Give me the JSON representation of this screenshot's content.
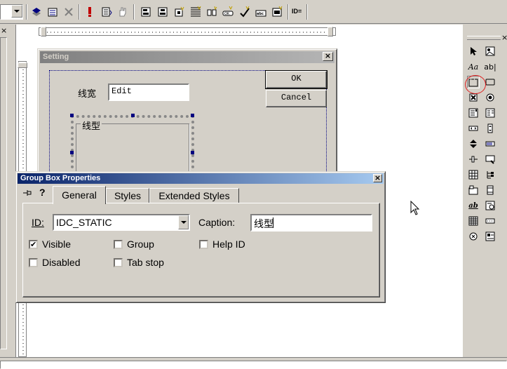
{
  "toolbar": {
    "icons": [
      "dropdown-arrow-icon",
      "class-wizard-icon",
      "resource-icon",
      "cut-disabled-icon",
      "exclamation-icon",
      "list-icon",
      "hand-icon",
      "align-left-icon",
      "align-center-icon",
      "align-right-icon",
      "space-across-icon",
      "make-same-size-icon",
      "size-to-content-icon",
      "check-mnemonics-icon",
      "grid-icon"
    ],
    "id_label": "ID="
  },
  "setting_dialog": {
    "title": "Setting",
    "width_label": "线宽",
    "edit_text": "Edit",
    "group_label": "线型",
    "ok_label": "OK",
    "cancel_label": "Cancel"
  },
  "props": {
    "title": "Group Box Properties",
    "tabs": [
      "General",
      "Styles",
      "Extended Styles"
    ],
    "id_label": "ID:",
    "id_value": "IDC_STATIC",
    "caption_label": "Caption:",
    "caption_value": "线型",
    "visible_label": "Visible",
    "visible_checked": "✔",
    "disabled_label": "Disabled",
    "group_label": "Group",
    "tabstop_label": "Tab stop",
    "helpid_label": "Help ID"
  },
  "controls_palette": {
    "items": [
      "pointer",
      "picture",
      "static-text",
      "edit-box",
      "group-box",
      "button",
      "check-box",
      "radio-button",
      "combo-box",
      "list-box",
      "horizontal-scrollbar",
      "vertical-scrollbar",
      "spin",
      "progress",
      "slider",
      "hotkey",
      "list-control",
      "tree-control",
      "tab-control",
      "animate",
      "rich-edit",
      "datetime-picker",
      "month-calendar",
      "ip-address",
      "custom-control",
      "extended-combo"
    ],
    "labels": {
      "static_text": "Aa",
      "edit": "ab|"
    },
    "highlighted": "group-box"
  },
  "colors": {
    "title_active": "#0a246a",
    "title_inactive": "#808080",
    "face": "#d4d0c8",
    "highlight_circle": "#e02020"
  }
}
